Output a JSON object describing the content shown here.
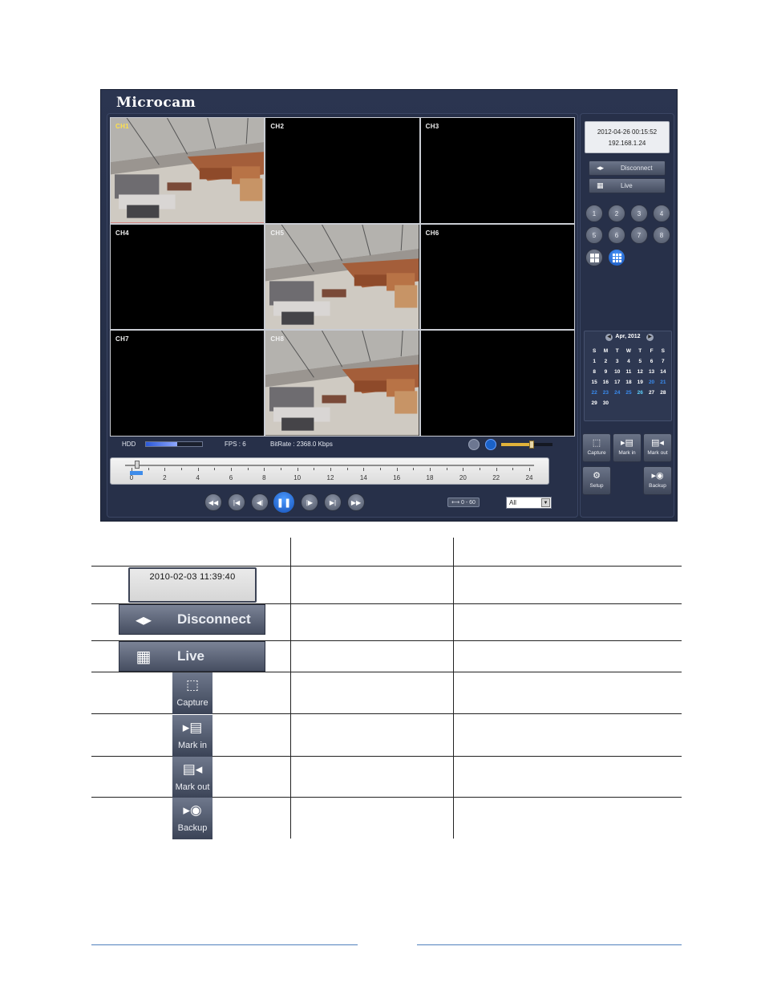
{
  "app": {
    "brand": "Microcam",
    "channels": [
      {
        "label": "CH1",
        "video": true,
        "active": true
      },
      {
        "label": "CH2",
        "video": false,
        "active": false
      },
      {
        "label": "CH3",
        "video": false,
        "active": false
      },
      {
        "label": "CH4",
        "video": false,
        "active": false
      },
      {
        "label": "CH5",
        "video": true,
        "active": false
      },
      {
        "label": "CH6",
        "video": false,
        "active": false
      },
      {
        "label": "CH7",
        "video": false,
        "active": false
      },
      {
        "label": "CH8",
        "video": true,
        "active": false
      },
      {
        "label": "",
        "video": false,
        "active": false
      }
    ],
    "status": {
      "hdd_label": "HDD",
      "hdd_usage": 0.55,
      "fps": "FPS :  6",
      "bitrate": "BitRate : 2368.0 Kbps",
      "volume_level": 0.55
    },
    "timeline": {
      "ticks": [
        "0",
        "2",
        "4",
        "6",
        "8",
        "10",
        "12",
        "14",
        "16",
        "18",
        "20",
        "22",
        "24"
      ]
    },
    "playback": {
      "range_label": "⟷ 0 - 60",
      "filter_value": "All"
    },
    "side": {
      "datetime": "2012-04-26 00:15:52",
      "ip": "192.168.1.24",
      "disconnect_label": "Disconnect",
      "live_label": "Live",
      "channel_buttons": [
        "1",
        "2",
        "3",
        "4",
        "5",
        "6",
        "7",
        "8"
      ]
    },
    "calendar": {
      "month": "Apr, 2012",
      "weekdays": [
        "S",
        "M",
        "T",
        "W",
        "T",
        "F",
        "S"
      ],
      "days": [
        {
          "d": "1"
        },
        {
          "d": "2"
        },
        {
          "d": "3"
        },
        {
          "d": "4"
        },
        {
          "d": "5"
        },
        {
          "d": "6"
        },
        {
          "d": "7"
        },
        {
          "d": "8"
        },
        {
          "d": "9"
        },
        {
          "d": "10"
        },
        {
          "d": "11"
        },
        {
          "d": "12"
        },
        {
          "d": "13"
        },
        {
          "d": "14"
        },
        {
          "d": "15"
        },
        {
          "d": "16"
        },
        {
          "d": "17"
        },
        {
          "d": "18"
        },
        {
          "d": "19"
        },
        {
          "d": "20",
          "dim": true
        },
        {
          "d": "21",
          "dim": true
        },
        {
          "d": "22",
          "dim": true
        },
        {
          "d": "23",
          "dim": true
        },
        {
          "d": "24",
          "dim": true
        },
        {
          "d": "25",
          "dim": true
        },
        {
          "d": "26",
          "today": true
        },
        {
          "d": "27"
        },
        {
          "d": "28"
        },
        {
          "d": "29"
        },
        {
          "d": "30"
        }
      ]
    },
    "tools": {
      "capture": "Capture",
      "mark_in": "Mark in",
      "mark_out": "Mark out",
      "setup": "Setup",
      "backup": "Backup"
    }
  },
  "table": {
    "timestamp": "2010-02-03 11:39:40",
    "disconnect": "Disconnect",
    "live": "Live",
    "capture": "Capture",
    "mark_in": "Mark in",
    "mark_out": "Mark out",
    "backup": "Backup"
  },
  "colors": {
    "app_bg": "#2b3550",
    "accent_blue": "#1b62c8",
    "active_border": "#d73434",
    "footer_line": "#4f81bd"
  }
}
